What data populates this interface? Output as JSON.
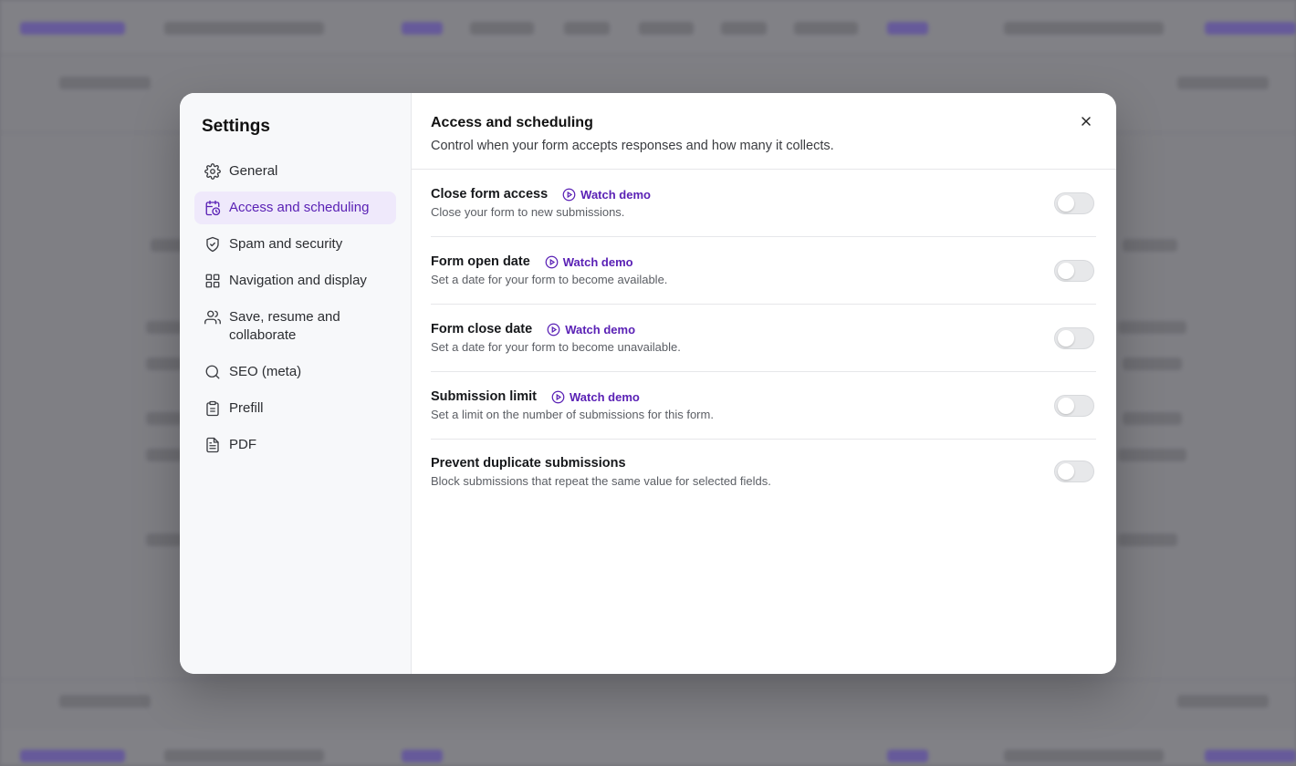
{
  "sidebar": {
    "title": "Settings",
    "items": [
      {
        "label": "General"
      },
      {
        "label": "Access and scheduling"
      },
      {
        "label": "Spam and security"
      },
      {
        "label": "Navigation and display"
      },
      {
        "label": "Save, resume and collaborate"
      },
      {
        "label": "SEO (meta)"
      },
      {
        "label": "Prefill"
      },
      {
        "label": "PDF"
      }
    ],
    "active_item": "Access and scheduling"
  },
  "main": {
    "title": "Access and scheduling",
    "subtitle": "Control when your form accepts responses and how many it collects.",
    "watch_demo_label": "Watch demo",
    "settings": [
      {
        "label": "Close form access",
        "description": "Close your form to new submissions.",
        "has_demo": true,
        "enabled": false
      },
      {
        "label": "Form open date",
        "description": "Set a date for your form to become available.",
        "has_demo": true,
        "enabled": false
      },
      {
        "label": "Form close date",
        "description": "Set a date for your form to become unavailable.",
        "has_demo": true,
        "enabled": false
      },
      {
        "label": "Submission limit",
        "description": "Set a limit on the number of submissions for this form.",
        "has_demo": true,
        "enabled": false
      },
      {
        "label": "Prevent duplicate submissions",
        "description": "Block submissions that repeat the same value for selected fields.",
        "has_demo": false,
        "enabled": false
      }
    ]
  },
  "colors": {
    "accent": "#5a21b5",
    "active_bg": "#efe9fb",
    "sidebar_bg": "#f7f8fa"
  }
}
